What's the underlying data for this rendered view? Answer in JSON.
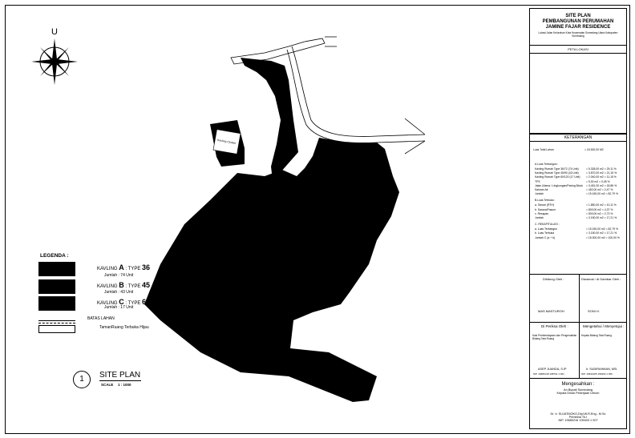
{
  "north": {
    "label": "U"
  },
  "map": {
    "site_label": "Kavling Cluster"
  },
  "legend": {
    "title": "LEGENDA :",
    "items": [
      {
        "kavling": "KAVLING",
        "letter": "A",
        "type": ": TYPE",
        "type_num": "36",
        "count": "Jumlah : 74 Unit"
      },
      {
        "kavling": "KAVLING",
        "letter": "B",
        "type": ": TYPE",
        "type_num": "45",
        "count": "Jumlah : 43 Unit"
      },
      {
        "kavling": "KAVLING",
        "letter": "C",
        "type": ": TYPE",
        "type_num": "60",
        "count": "Jumlah : 17 Unit"
      }
    ],
    "batas": "BATAS LAHAN",
    "taman": "TamanRuang Terbuka Hijau"
  },
  "caption": {
    "number": "1",
    "title": "SITE PLAN",
    "scale_label": "SCALE",
    "scale_value": "1 : 1000"
  },
  "titleblock": {
    "title_lines": [
      "SITE PLAN",
      "PEMBANGUNAN PERUMAHAN",
      "JAMINE FAJAR RESIDENCE"
    ],
    "address": "Lokasi Jalan Kelurahan Kota Kecamatan Sumedang Utara Kabupaten Sumedang",
    "peta_lokasi": "PETA LOKASI",
    "keterangan": "KETERANGAN",
    "luas_total": "Luas Total Lahan",
    "luas_total_val": "= 18.300,00 M2",
    "rows": [
      {
        "label": "A.Luas Terbangun :",
        "val": ""
      },
      {
        "label": "Kavling Rumah Type 36/72 (74 Unit)",
        "val": "= 5.328,00 m2 =  29,11 %"
      },
      {
        "label": "Kavling Rumah Type 45/90 (43 Unit)",
        "val": "= 3.870,00 m2 =  21,15 %"
      },
      {
        "label": "Kavling Rumah Type 60/120 (17 Unit)",
        "val": "= 2.040,00 m2 =  11,15 %"
      },
      {
        "label": "TPS",
        "val": "= 9,00 m2 =  0,05 %"
      },
      {
        "label": "Jalan Utama / Lingkungan/Paving Block",
        "val": "= 3.451,00 m2 =  18,86 %"
      },
      {
        "label": "Saluran Air",
        "val": "= 452,00 m2 =  2,47 %"
      },
      {
        "label": "Jumlah",
        "val": "= 15.150,00 m2 = 82,79 %"
      },
      {
        "label": "B.Luas Terbuka :",
        "val": ""
      },
      {
        "label": "a. Taman (RTH)",
        "val": "= 1.850,00 m2 =  10,11 %"
      },
      {
        "label": "b. Sarana/Fasum",
        "val": "= 800,00 m2 =  4,37 %"
      },
      {
        "label": "c. Resapan",
        "val": "= 500,00 m2 =  2,73 %"
      },
      {
        "label": "Jumlah",
        "val": "= 3.150,00 m2 = 17,21 %"
      },
      {
        "label": "C. REKAPITULASI :",
        "val": ""
      },
      {
        "label": "a. Luas Terbangun",
        "val": "= 15.150,00 m2 = 82,79 %"
      },
      {
        "label": "b. Luas Terbuka",
        "val": "= 3.150,00 m2 = 17,21 %"
      },
      {
        "label": "Jumlah C (a + b)",
        "val": "= 18.300,00 m2 = 100,00 %"
      }
    ],
    "dihitung_oleh": "Dihitung Oleh :",
    "digambar_oleh": "Diwarnai / di Gambar Oleh :",
    "name1": "MAS MASTUROH",
    "name2": "SONI H.",
    "diperiksa": "Di Periksa Oleh :",
    "mengetahui": "Mengetahui / Menyetujui :",
    "jabatan1": "Kasi Pemberdayaan dan Pengendalian Bidang Tata Ruang",
    "jabatan2": "Kepala Bidang Tata Ruang",
    "pejabat1": "ASEP JUANDA, S.IP",
    "pejabat2": "Ir. SUDIRAHMAN, MSi",
    "nip1": "NIP. 19681018 198701 1 001",
    "nip2": "NIP. 19641005 199403 1 006",
    "mengesahkan": "Mengesahkan :",
    "an_bupati": "An.Bupati Sumedang",
    "kepala_dinas": "Kepala Dinas Pekerjaan Umum",
    "kadis_name": "Dr. Ir. SUJATMOKO,Dipl.W.R.Eng., M.Sc",
    "pangkat": "Pembina Tk.I",
    "nip3": "NIP. 19680216 199403 1 007"
  }
}
